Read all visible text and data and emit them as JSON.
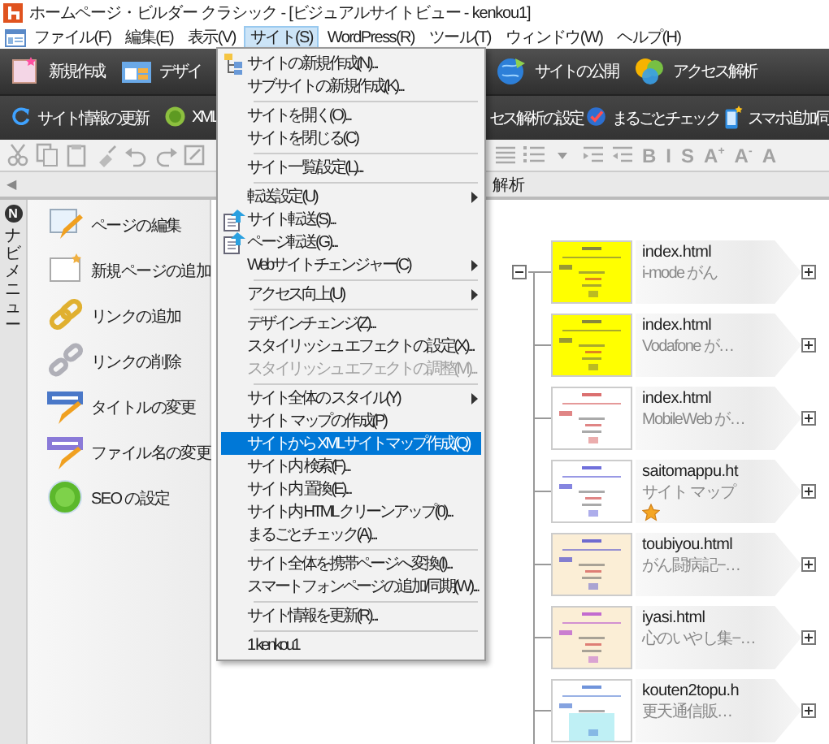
{
  "window": {
    "title": "ホームページ・ビルダー クラシック - [ビジュアルサイトビュー - kenkou1]"
  },
  "menu_bar": [
    {
      "label": "ファイル(F)",
      "selected": false
    },
    {
      "label": "編集(E)",
      "selected": false
    },
    {
      "label": "表示(V)",
      "selected": false
    },
    {
      "label": "サイト(S)",
      "selected": true
    },
    {
      "label": "WordPress(R)",
      "selected": false
    },
    {
      "label": "ツール(T)",
      "selected": false
    },
    {
      "label": "ウィンドウ(W)",
      "selected": false
    },
    {
      "label": "ヘルプ(H)",
      "selected": false
    }
  ],
  "toolbar_main": {
    "left": [
      {
        "label": "新規作成",
        "kind": "new"
      },
      {
        "label": "デザイ",
        "kind": "design"
      }
    ],
    "right": [
      {
        "label": "サイトの公開",
        "kind": "publish"
      },
      {
        "label": "アクセス解析",
        "kind": "analytics"
      }
    ]
  },
  "toolbar_site": {
    "left": [
      {
        "label": "サイト情報の更新",
        "kind": "refresh"
      },
      {
        "label": "XML",
        "kind": "xml"
      }
    ],
    "right": [
      {
        "label": "セス解析の設定",
        "kind": "none"
      },
      {
        "label": "まるごとチェック",
        "kind": "check"
      },
      {
        "label": "スマホ追加/同",
        "kind": "phone"
      }
    ]
  },
  "format_buttons": [
    {
      "label": "B",
      "disabled": true
    },
    {
      "label": "I",
      "disabled": true
    },
    {
      "label": "S",
      "disabled": true
    },
    {
      "label": "A$^{+}$",
      "disabled": true
    },
    {
      "label": "A$^{-}$",
      "disabled": true
    },
    {
      "label": "A",
      "disabled": true
    }
  ],
  "view_header": {
    "collapse_arrow": "◀",
    "label": "解析"
  },
  "nav_tab": {
    "badge": "N",
    "label": "ナビメニュー"
  },
  "nav_menu": [
    {
      "label": "ページの編集",
      "kind": "edit"
    },
    {
      "label": "新規ページの追加",
      "kind": "new"
    },
    {
      "label": "リンクの追加",
      "kind": "link"
    },
    {
      "label": "リンクの削除",
      "kind": "unlink"
    },
    {
      "label": "タイトルの変更",
      "kind": "title"
    },
    {
      "label": "ファイル名の変更",
      "kind": "filename"
    },
    {
      "label": "SEO の設定",
      "kind": "seo"
    }
  ],
  "site_menu": [
    {
      "kind": "sitenew",
      "label": "サイトの新規作成(N)...",
      "selected": false,
      "disabled": false,
      "submenu": false
    },
    {
      "kind": "plain",
      "label": "サブサイトの新規作成(K)...",
      "selected": false,
      "disabled": false,
      "submenu": false
    },
    {
      "kind": "separator"
    },
    {
      "kind": "plain",
      "label": "サイトを開く(O)...",
      "selected": false,
      "disabled": false,
      "submenu": false
    },
    {
      "kind": "plain",
      "label": "サイトを閉じる(C)",
      "selected": false,
      "disabled": false,
      "submenu": false
    },
    {
      "kind": "separator"
    },
    {
      "kind": "plain",
      "label": "サイト一覧/設定(L)...",
      "selected": false,
      "disabled": false,
      "submenu": false
    },
    {
      "kind": "separator"
    },
    {
      "kind": "plain",
      "label": "転送設定(U)",
      "selected": false,
      "disabled": false,
      "submenu": true
    },
    {
      "kind": "transfer",
      "label": "サイト転送(S)...",
      "selected": false,
      "disabled": false,
      "submenu": false
    },
    {
      "kind": "transfer",
      "label": "ページ転送(G)...",
      "selected": false,
      "disabled": false,
      "submenu": false
    },
    {
      "kind": "plain",
      "label": "Webサイトチェンジャー(C)",
      "selected": false,
      "disabled": false,
      "submenu": true
    },
    {
      "kind": "separator"
    },
    {
      "kind": "plain",
      "label": "アクセス向上(U)",
      "selected": false,
      "disabled": false,
      "submenu": true
    },
    {
      "kind": "separator"
    },
    {
      "kind": "plain",
      "label": "デザインチェンジ(Z)...",
      "selected": false,
      "disabled": false,
      "submenu": false
    },
    {
      "kind": "plain",
      "label": "スタイリッシュ エフェクトの設定(X)...",
      "selected": false,
      "disabled": false,
      "submenu": false
    },
    {
      "kind": "plain",
      "label": "スタイリッシュ エフェクトの調整(M)...",
      "selected": false,
      "disabled": true,
      "submenu": false
    },
    {
      "kind": "separator"
    },
    {
      "kind": "plain",
      "label": "サイト全体の スタイル(Y)",
      "selected": false,
      "disabled": false,
      "submenu": true
    },
    {
      "kind": "plain",
      "label": "サイト マップの作成(P)",
      "selected": false,
      "disabled": false,
      "submenu": false
    },
    {
      "kind": "plain",
      "label": "サイトから XML サイトマップ作成(Q)",
      "selected": true,
      "disabled": false,
      "submenu": false
    },
    {
      "kind": "plain",
      "label": "サイト内 検索(F)...",
      "selected": false,
      "disabled": false,
      "submenu": false
    },
    {
      "kind": "plain",
      "label": "サイト内 置換(E)...",
      "selected": false,
      "disabled": false,
      "submenu": false
    },
    {
      "kind": "plain",
      "label": "サイト内 HTML クリーンアップ(0)...",
      "selected": false,
      "disabled": false,
      "submenu": false
    },
    {
      "kind": "plain",
      "label": "まるごとチェック(A)...",
      "selected": false,
      "disabled": false,
      "submenu": false
    },
    {
      "kind": "separator"
    },
    {
      "kind": "plain",
      "label": "サイト全体を携帯ページへ変換(I)...",
      "selected": false,
      "disabled": false,
      "submenu": false
    },
    {
      "kind": "plain",
      "label": "スマートフォンページの追加/同期(W)...",
      "selected": false,
      "disabled": false,
      "submenu": false
    },
    {
      "kind": "separator"
    },
    {
      "kind": "plain",
      "label": "サイト情報を更新(R)...",
      "selected": false,
      "disabled": false,
      "submenu": false
    },
    {
      "kind": "separator"
    },
    {
      "kind": "plain",
      "label": "1 kenkou1",
      "selected": false,
      "disabled": false,
      "submenu": false
    }
  ],
  "site_tree": [
    {
      "file": "index.html",
      "title": "i-mode がん",
      "starred": false
    },
    {
      "file": "index.html",
      "title": "Vodafone が…",
      "starred": false
    },
    {
      "file": "index.html",
      "title": "MobileWeb が…",
      "starred": false
    },
    {
      "file": "saitomappu.ht",
      "title": "サイト マップ",
      "starred": true
    },
    {
      "file": "toubiyou.html",
      "title": "がん闘病記−…",
      "starred": false
    },
    {
      "file": "iyasi.html",
      "title": "心のいやし集−…",
      "starred": false
    },
    {
      "file": "kouten2topu.h",
      "title": "更天通信販…",
      "starred": false
    }
  ]
}
